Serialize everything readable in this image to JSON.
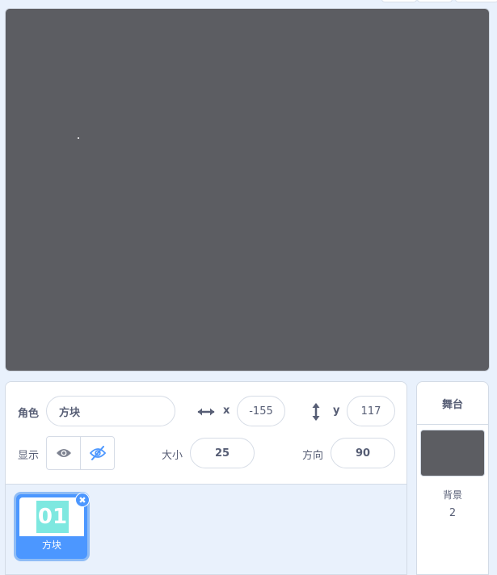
{
  "sprite_info": {
    "sprite_label": "角色",
    "sprite_name": "方块",
    "x_label": "x",
    "x_value": "-155",
    "y_label": "y",
    "y_value": "117",
    "show_label": "显示",
    "size_label": "大小",
    "size_value": "25",
    "direction_label": "方向",
    "direction_value": "90"
  },
  "sprite_list": {
    "items": [
      {
        "name": "方块",
        "thumbnail_text": "01",
        "selected": true
      }
    ]
  },
  "stage_panel": {
    "title": "舞台",
    "backdrops_label": "背景",
    "backdrops_count": "2"
  },
  "colors": {
    "stage_background": "#5c5d62",
    "accent": "#4c97ff",
    "panel_background": "#e9f1fc",
    "thumbnail_fill": "#7ee8e0"
  }
}
